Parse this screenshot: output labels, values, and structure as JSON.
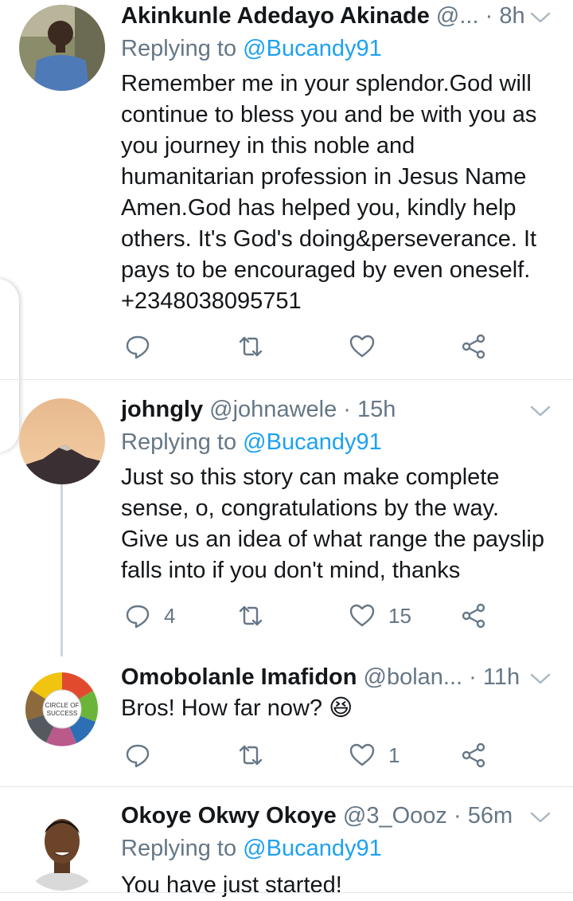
{
  "tweets": [
    {
      "name": "Akinkunle Adedayo Akinade",
      "handle": "@...",
      "time": "8h",
      "replying_label": "Replying to",
      "replying_to": "@Bucandy91",
      "text_lines": [
        "Remember me in your splendor.God will",
        "continue to bless you and be with you as",
        "you journey in this noble and",
        "humanitarian profession in Jesus Name",
        "Amen.God has helped you, kindly help",
        "others. It's God's doing&perseverance. It",
        "pays to be encouraged by even oneself.",
        "+2348038095751"
      ],
      "reply_count": "",
      "like_count": ""
    },
    {
      "name": "johngly",
      "handle": "@johnawele",
      "time": "15h",
      "replying_label": "Replying to",
      "replying_to": "@Bucandy91",
      "text_lines": [
        "Just so this story can make complete",
        "sense, o, congratulations by the way.",
        "Give us an idea of what range the payslip",
        "falls into if you don't mind, thanks"
      ],
      "reply_count": "4",
      "like_count": "15"
    },
    {
      "name": "Omobolanle Imafidon",
      "handle": "@bolan...",
      "time": "11h",
      "text": "Bros! How far now? 😆",
      "reply_count": "",
      "like_count": "1",
      "avatar_lines": [
        "CIRCLE OF",
        "SUCCESS"
      ]
    },
    {
      "name": "Okoye Okwy Okoye",
      "handle": "@3_Oooz",
      "time": "56m",
      "replying_label": "Replying to",
      "replying_to": "@Bucandy91",
      "text": "You have just started!"
    }
  ],
  "icons": {
    "reply": "reply-icon",
    "retweet": "retweet-icon",
    "like": "like-icon",
    "share": "share-icon",
    "more": "chevron-down-icon"
  },
  "colors": {
    "accent": "#1da1f2",
    "secondary_text": "#657786",
    "divider": "#e1e8ed"
  }
}
